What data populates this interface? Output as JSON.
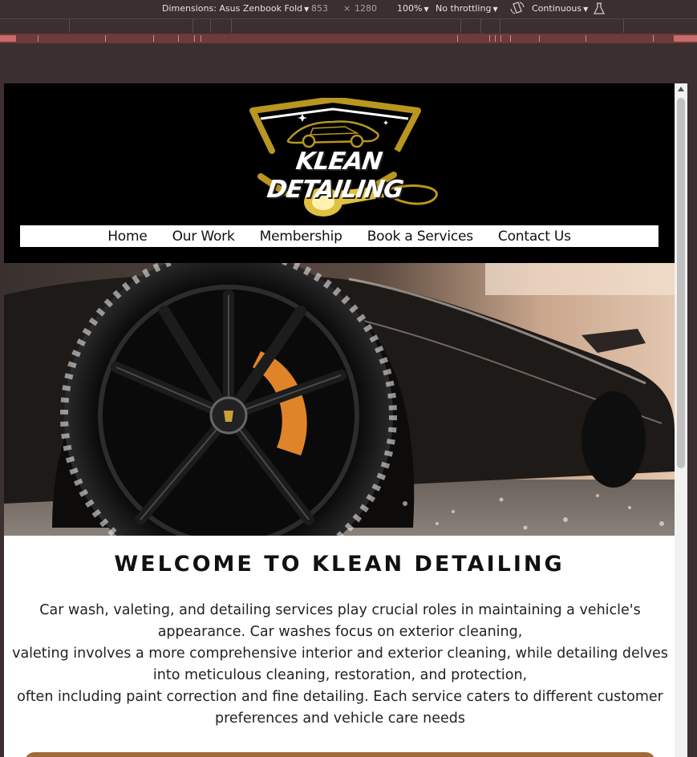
{
  "devtools": {
    "dimensions_label": "Dimensions: Asus Zenbook Fold",
    "width": "853",
    "times": "×",
    "height": "1280",
    "zoom": "100%",
    "throttling": "No throttling",
    "mode": "Continuous",
    "icons": [
      "rotate-icon",
      "flask-icon",
      "caret-down-icon"
    ]
  },
  "site": {
    "logo_text": "KLEAN DETAILING",
    "nav": [
      "Home",
      "Our Work",
      "Membership",
      "Book a Services",
      "Contact Us"
    ],
    "welcome_title": "WELCOME TO KLEAN DETAILING",
    "intro_lines": [
      "Car wash, valeting, and detailing services play crucial roles in maintaining a vehicle's appearance. Car washes focus on exterior cleaning,",
      "valeting involves a more comprehensive interior and exterior cleaning, while detailing delves into meticulous cleaning, restoration, and protection,",
      "often including paint correction and fine detailing. Each service caters to different customer preferences and vehicle care needs"
    ]
  },
  "colors": {
    "logo_gold": "#b8961f",
    "header_bg": "#000000",
    "cta_brown": "#a06a3a",
    "devtools_bg": "#3b2f2f"
  }
}
